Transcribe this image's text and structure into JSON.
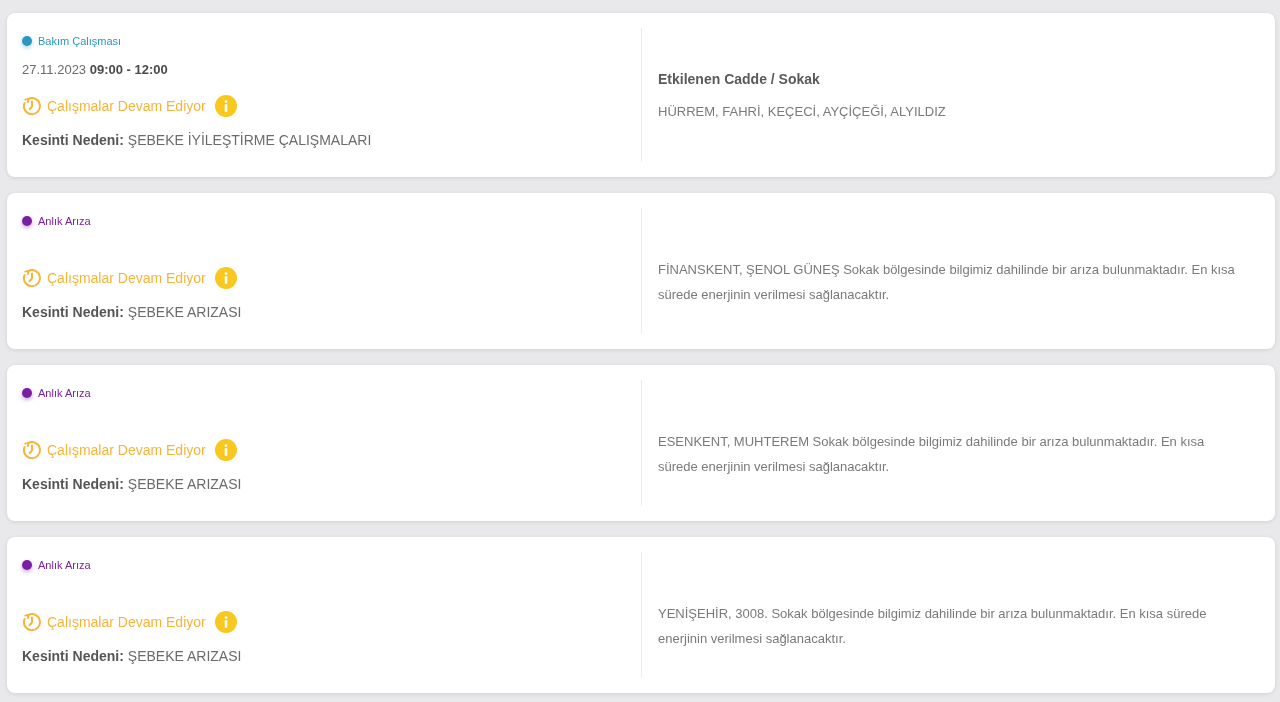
{
  "outages": [
    {
      "kind": "planned",
      "tag": {
        "label": "Bakım Çalışması",
        "color": "#2b96c2"
      },
      "date_time": "27.11.2023 **09:00 - 12:00**",
      "status": "Çalışmalar Devam Ediyor",
      "reason": "**Kesinti Nedeni:** ŞEBEKE İYİLEŞTİRME ÇALIŞMALARI",
      "streets_heading": "Etkilenen Cadde / Sokak",
      "streets": "HÜRREM, FAHRİ, KEÇECİ, AYÇİÇEĞİ, ALYILDIZ"
    },
    {
      "kind": "fault",
      "tag": {
        "label": "Anlık Arıza",
        "color": "#7b1fa2"
      },
      "status": "Çalışmalar Devam Ediyor",
      "reason": "**Kesinti Nedeni:** ŞEBEKE ARIZASI",
      "description": "FİNANSKENT, ŞENOL GÜNEŞ Sokak bölgesinde bilgimiz dahilinde bir arıza bulunmaktadır. En kısa sürede enerjinin verilmesi sağlanacaktır."
    },
    {
      "kind": "fault",
      "tag": {
        "label": "Anlık Arıza",
        "color": "#7b1fa2"
      },
      "status": "Çalışmalar Devam Ediyor",
      "reason": "**Kesinti Nedeni:** ŞEBEKE ARIZASI",
      "description": "ESENKENT, MUHTEREM Sokak bölgesinde bilgimiz dahilinde bir arıza bulunmaktadır. En kısa sürede enerjinin verilmesi sağlanacaktır."
    },
    {
      "kind": "fault",
      "tag": {
        "label": "Anlık Arıza",
        "color": "#7b1fa2"
      },
      "status": "Çalışmalar Devam Ediyor",
      "reason": "**Kesinti Nedeni:** ŞEBEKE ARIZASI",
      "description": "YENİŞEHİR, 3008. Sokak bölgesinde bilgimiz dahilinde bir arıza bulunmaktadır. En kısa sürede enerjinin verilmesi sağlanacaktır."
    }
  ]
}
